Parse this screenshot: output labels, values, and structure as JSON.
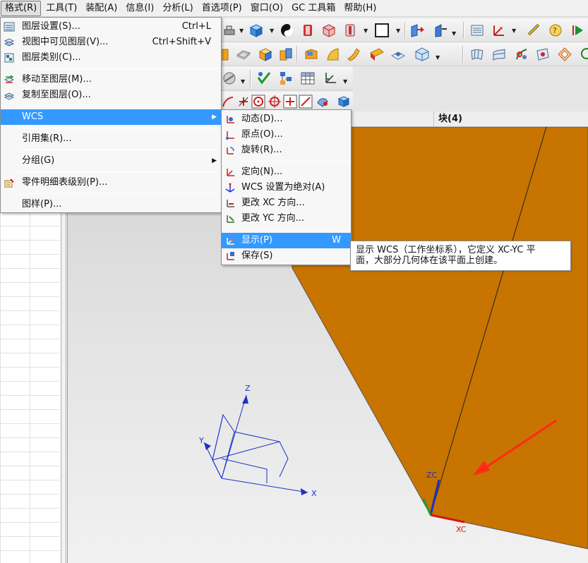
{
  "menubar": [
    {
      "label": "格式(R)",
      "active": true
    },
    {
      "label": "工具(T)"
    },
    {
      "label": "装配(A)"
    },
    {
      "label": "信息(I)"
    },
    {
      "label": "分析(L)"
    },
    {
      "label": "首选项(P)"
    },
    {
      "label": "窗口(O)"
    },
    {
      "label": "GC 工具箱"
    },
    {
      "label": "帮助(H)"
    }
  ],
  "format_menu": {
    "groups": [
      [
        {
          "label": "图层设置(S)...",
          "shortcut": "Ctrl+L",
          "icon": "layer-settings-icon"
        },
        {
          "label": "视图中可见图层(V)...",
          "shortcut": "Ctrl+Shift+V",
          "icon": "visible-layers-icon"
        },
        {
          "label": "图层类别(C)...",
          "icon": "layer-category-icon"
        }
      ],
      [
        {
          "label": "移动至图层(M)...",
          "icon": "move-to-layer-icon"
        },
        {
          "label": "复制至图层(O)...",
          "icon": "copy-to-layer-icon"
        }
      ],
      [
        {
          "label": "WCS",
          "submenu": true,
          "highlighted": true
        }
      ],
      [
        {
          "label": "引用集(R)..."
        }
      ],
      [
        {
          "label": "分组(G)",
          "submenu": true
        }
      ],
      [
        {
          "label": "零件明细表级别(P)...",
          "icon": "parts-list-icon"
        }
      ],
      [
        {
          "label": "图样(P)..."
        }
      ]
    ]
  },
  "wcs_menu": {
    "groups": [
      [
        {
          "label": "动态(D)...",
          "icon": "wcs-dynamic-icon"
        },
        {
          "label": "原点(O)...",
          "icon": "wcs-origin-icon"
        },
        {
          "label": "旋转(R)...",
          "icon": "wcs-rotate-icon"
        }
      ],
      [
        {
          "label": "定向(N)...",
          "icon": "wcs-orient-icon"
        },
        {
          "label": "WCS 设置为绝对(A)",
          "icon": "wcs-absolute-icon"
        },
        {
          "label": "更改 XC 方向...",
          "icon": "change-xc-icon"
        },
        {
          "label": "更改 YC 方向...",
          "icon": "change-yc-icon"
        }
      ],
      [
        {
          "label": "显示(P)",
          "shortcut": "W",
          "icon": "wcs-display-icon",
          "highlighted": true
        },
        {
          "label": "保存(S)",
          "icon": "wcs-save-icon"
        }
      ]
    ]
  },
  "tooltip": {
    "line1": "显示 WCS（工作坐标系），它定义 XC-YC 平",
    "line2": "面，大部分几何体在该平面上创建。"
  },
  "navigator": {
    "column": "块(4)"
  },
  "axes": {
    "absolute": {
      "x": "X",
      "y": "Y",
      "z": "Z"
    },
    "wcs": {
      "xc": "XC",
      "zc": "ZC"
    }
  },
  "colors": {
    "menu_highlight": "#3399ff",
    "solid_face": "#c77400",
    "arrow": "#ff2a14",
    "axis_blue": "#1b32c8"
  }
}
